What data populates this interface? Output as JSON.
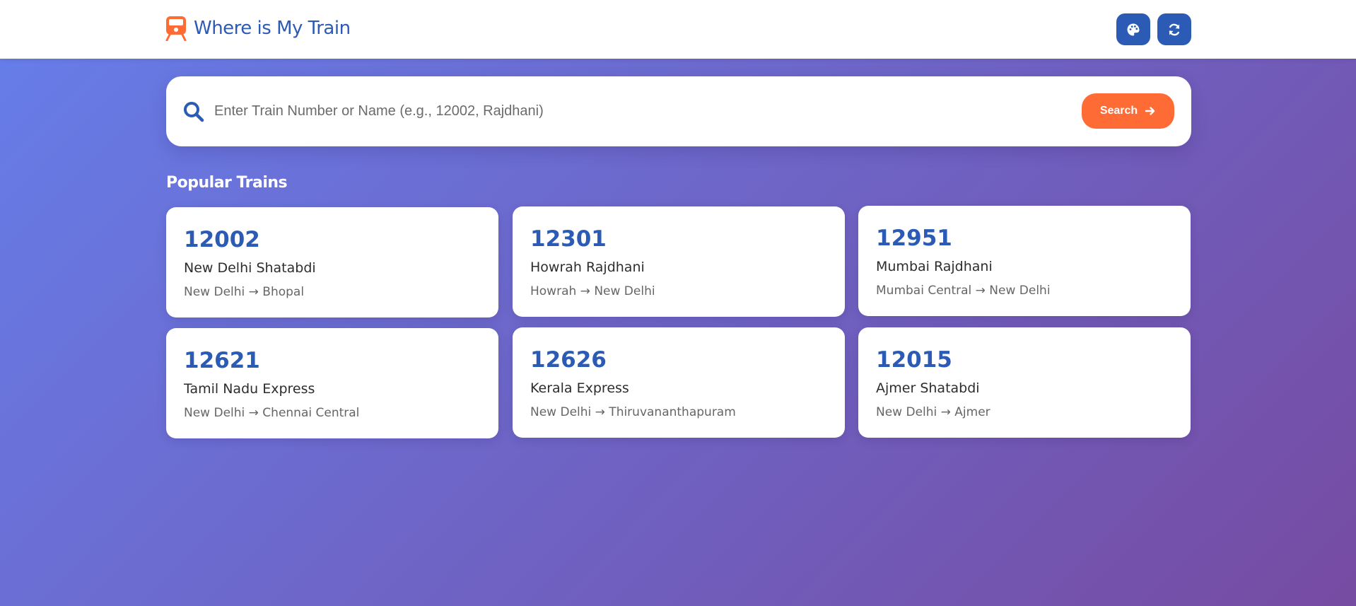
{
  "header": {
    "title": "Where is My Train",
    "brand_icon": "train-icon",
    "buttons": [
      {
        "icon": "palette-icon"
      },
      {
        "icon": "refresh-icon"
      }
    ],
    "colors": {
      "brand": "#2b5bb5",
      "icon": "#ff6b35"
    }
  },
  "search": {
    "placeholder": "Enter Train Number or Name (e.g., 12002, Rajdhani)",
    "value": "",
    "button_label": "Search",
    "icon": "search-icon",
    "button_icon": "arrow-right-icon",
    "button_color": "#ff6b35"
  },
  "popular": {
    "title": "Popular Trains",
    "trains": [
      {
        "number": "12002",
        "name": "New Delhi Shatabdi",
        "route": "New Delhi → Bhopal"
      },
      {
        "number": "12301",
        "name": "Howrah Rajdhani",
        "route": "Howrah → New Delhi"
      },
      {
        "number": "12951",
        "name": "Mumbai Rajdhani",
        "route": "Mumbai Central → New Delhi"
      },
      {
        "number": "12621",
        "name": "Tamil Nadu Express",
        "route": "New Delhi → Chennai Central"
      },
      {
        "number": "12626",
        "name": "Kerala Express",
        "route": "New Delhi → Thiruvananthapuram"
      },
      {
        "number": "12015",
        "name": "Ajmer Shatabdi",
        "route": "New Delhi → Ajmer"
      }
    ]
  },
  "background": {
    "gradient_start": "#667eea",
    "gradient_end": "#764ba2"
  }
}
